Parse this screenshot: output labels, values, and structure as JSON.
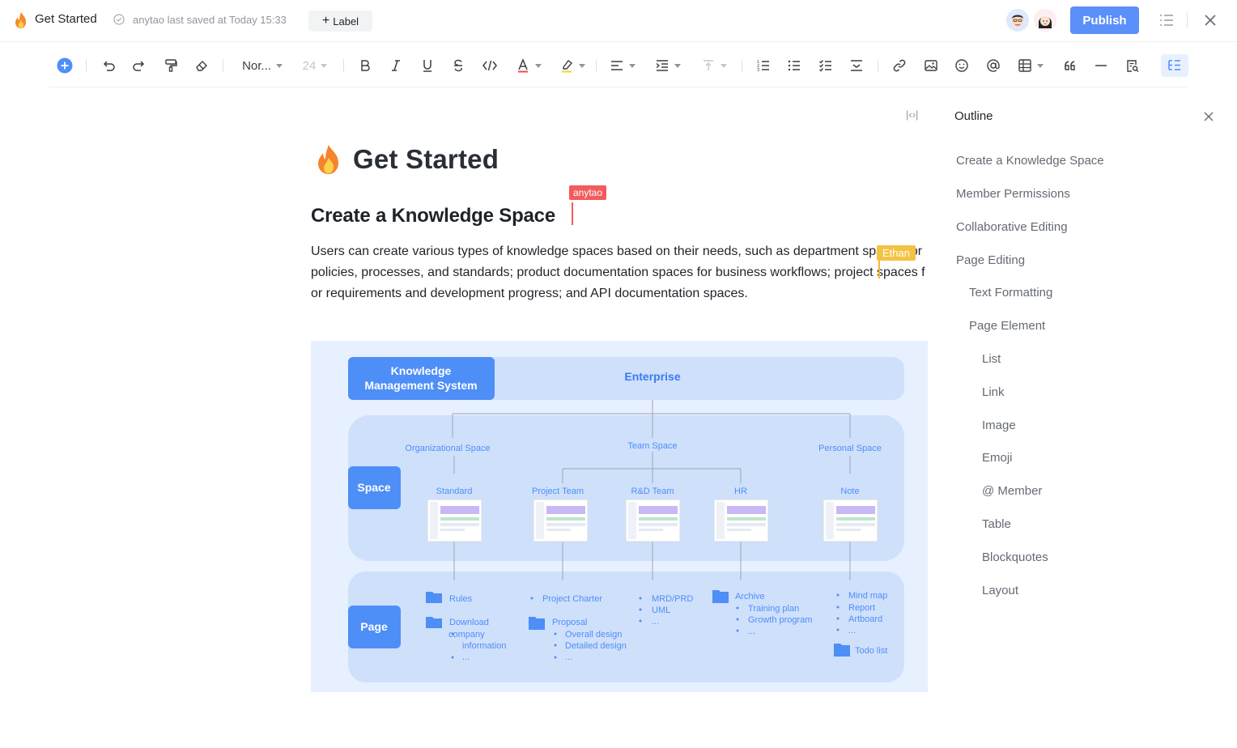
{
  "header": {
    "title": "Get Started",
    "saved_text": "anytao last saved at Today 15:33",
    "label_button": "Label",
    "publish_button": "Publish"
  },
  "toolbar": {
    "paragraph_style": "Nor...",
    "font_size": "24"
  },
  "document": {
    "title": "Get Started",
    "heading": "Create a Knowledge Space",
    "paragraph": "Users can create various types of knowledge spaces based on their needs, such as department spaces for policies, processes, and standards; product documentation spaces for business workflows; project spaces for requirements and development progress; and API documentation spaces.",
    "collaborators": [
      {
        "name": "anytao",
        "color": "#f25c5c"
      },
      {
        "name": "Ethan",
        "color": "#f5c343"
      }
    ]
  },
  "diagram": {
    "system_box": "Knowledge Management System",
    "enterprise": "Enterprise",
    "space_label": "Space",
    "page_label": "Page",
    "space_types": [
      "Organizational Space",
      "Team Space",
      "Personal Space"
    ],
    "spaces": [
      "Standard",
      "Project Team",
      "R&D Team",
      "HR",
      "Note"
    ],
    "pages": {
      "standard": [
        "Rules",
        "Download",
        "company",
        "information",
        "..."
      ],
      "project_team": [
        "Project Charter",
        "Proposal",
        "Overall design",
        "Detailed design",
        "..."
      ],
      "rd_team": [
        "MRD/PRD",
        "UML",
        "..."
      ],
      "hr": [
        "Archive",
        "Training plan",
        "Growth program",
        "..."
      ],
      "note": [
        "Mind map",
        "Report",
        "Artboard",
        "...",
        "Todo list"
      ]
    }
  },
  "outline": {
    "title": "Outline",
    "items": [
      {
        "label": "Create a Knowledge Space",
        "level": 1
      },
      {
        "label": "Member Permissions",
        "level": 1
      },
      {
        "label": "Collaborative Editing",
        "level": 1
      },
      {
        "label": "Page Editing",
        "level": 1
      },
      {
        "label": "Text Formatting",
        "level": 2
      },
      {
        "label": "Page Element",
        "level": 2
      },
      {
        "label": "List",
        "level": 3
      },
      {
        "label": "Link",
        "level": 3
      },
      {
        "label": "Image",
        "level": 3
      },
      {
        "label": "Emoji",
        "level": 3
      },
      {
        "label": "@ Member",
        "level": 3
      },
      {
        "label": "Table",
        "level": 3
      },
      {
        "label": "Blockquotes",
        "level": 3
      },
      {
        "label": "Layout",
        "level": 3
      }
    ]
  },
  "colors": {
    "accent": "#5b8ff9",
    "diagram_bg": "#e7f0ff",
    "diagram_block": "#cfe0fb",
    "diagram_primary": "#4e8ef7"
  }
}
